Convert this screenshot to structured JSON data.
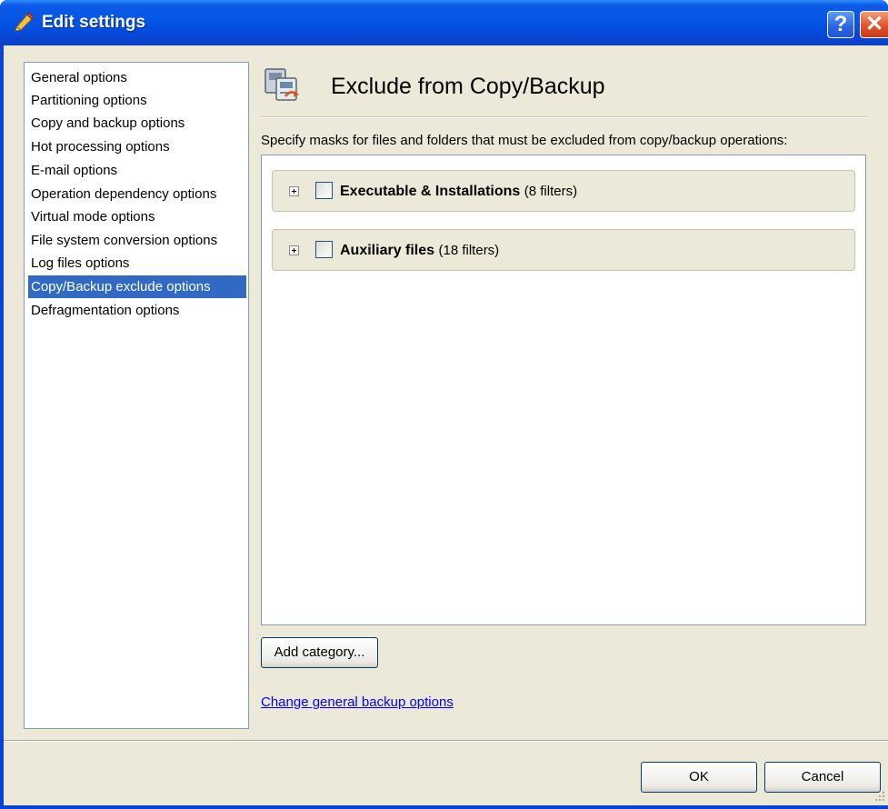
{
  "window": {
    "title": "Edit settings",
    "help_glyph": "?",
    "close_glyph": "✕"
  },
  "nav": {
    "items": [
      {
        "label": "General options"
      },
      {
        "label": "Partitioning options"
      },
      {
        "label": "Copy and backup options"
      },
      {
        "label": "Hot processing options"
      },
      {
        "label": "E-mail options"
      },
      {
        "label": "Operation dependency options"
      },
      {
        "label": "Virtual mode options"
      },
      {
        "label": "File system conversion options"
      },
      {
        "label": "Log files options"
      },
      {
        "label": "Copy/Backup exclude options",
        "selected": true
      },
      {
        "label": "Defragmentation options"
      }
    ]
  },
  "header": {
    "title": "Exclude from Copy/Backup",
    "icon": "backup-exclude-icon"
  },
  "description": "Specify masks for files and folders that must be excluded from copy/backup operations:",
  "categories": [
    {
      "name": "Executable & Installations",
      "count": "(8 filters)",
      "checked": false
    },
    {
      "name": "Auxiliary files",
      "count": "(18 filters)",
      "checked": false
    }
  ],
  "buttons": {
    "add_category": "Add category...",
    "ok": "OK",
    "cancel": "Cancel"
  },
  "link": "Change general backup options",
  "colors": {
    "titlebar": "#0457e6",
    "dialog_bg": "#ece9d8",
    "selection": "#316ac5",
    "link": "#0000ff"
  }
}
